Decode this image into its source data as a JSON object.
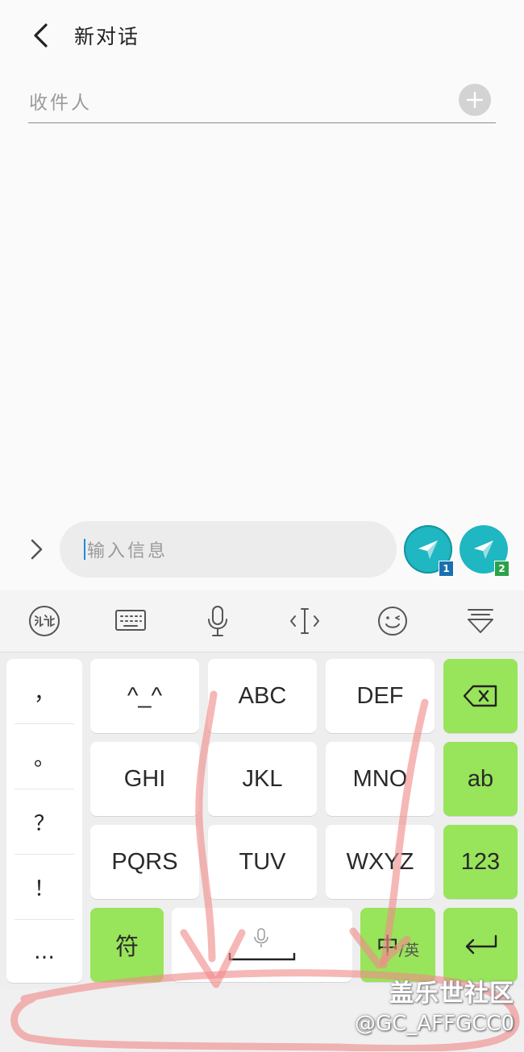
{
  "header": {
    "title": "新对话"
  },
  "recipient": {
    "placeholder": "收件人"
  },
  "compose": {
    "placeholder": "输入信息",
    "send_sim1": "1",
    "send_sim2": "2"
  },
  "keyboard": {
    "toolbar_icons": [
      "ifly-icon",
      "keyboard-icon",
      "microphone-icon",
      "cursor-icon",
      "emoji-icon",
      "hide-keyboard-icon"
    ],
    "symbols": [
      "，",
      "。",
      "？",
      "！",
      "…"
    ],
    "rows": [
      [
        "^_^",
        "ABC",
        "DEF"
      ],
      [
        "GHI",
        "JKL",
        "MNO"
      ],
      [
        "PQRS",
        "TUV",
        "WXYZ"
      ]
    ],
    "right": {
      "ab": "ab",
      "num": "123"
    },
    "bottom": {
      "symbol": "符",
      "lang_main": "中",
      "lang_sub": "/英"
    }
  },
  "watermark": {
    "line1": "盖乐世社区",
    "line2": "@GC_AFFGCC0"
  },
  "colors": {
    "accent": "#1fb7c1",
    "key_green": "#98e45a",
    "annotation": "#f08a8a"
  }
}
